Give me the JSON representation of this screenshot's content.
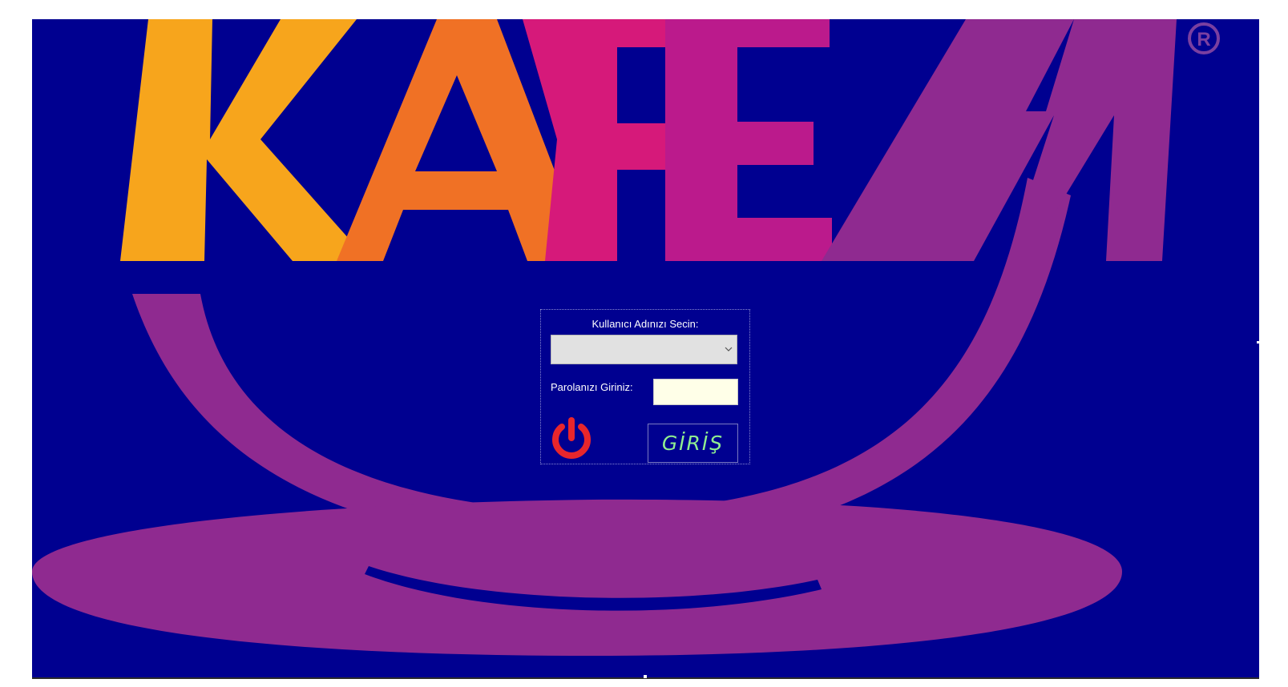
{
  "logo": {
    "text": "KAFEM",
    "registered_mark": "®",
    "colors": {
      "background": "#000090",
      "k": "#f7a51c",
      "a": "#f07125",
      "f": "#d6197a",
      "e": "#bb1a8c",
      "m": "#8f2a90",
      "cup": "#8f2a90"
    }
  },
  "login": {
    "user_label": "Kullanıcı Adınızı Secin:",
    "user_select_value": "",
    "password_label": "Parolanızı Giriniz:",
    "password_value": "",
    "login_button_label": "GİRİŞ",
    "power_icon": "power-icon",
    "colors": {
      "power": "#e8262c",
      "login_text": "#90ee90",
      "input_bg": "#ffffe8",
      "select_bg": "#e1e1e1"
    }
  }
}
